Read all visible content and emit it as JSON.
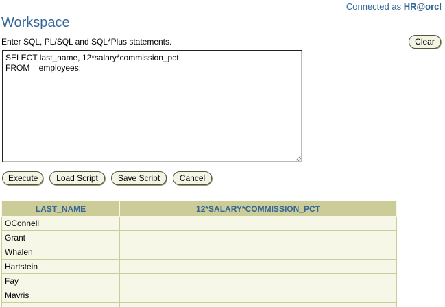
{
  "connection": {
    "prefix": "Connected as ",
    "user": "HR@orcl"
  },
  "page_title": "Workspace",
  "instructions": "Enter SQL, PL/SQL and SQL*Plus statements.",
  "buttons": {
    "clear": "Clear",
    "execute": "Execute",
    "load_script": "Load Script",
    "save_script": "Save Script",
    "cancel": "Cancel"
  },
  "editor": {
    "value": "SELECT last_name, 12*salary*commission_pct\nFROM    employees;"
  },
  "results": {
    "columns": [
      "LAST_NAME",
      "12*SALARY*COMMISSION_PCT"
    ],
    "rows": [
      [
        "OConnell",
        ""
      ],
      [
        "Grant",
        ""
      ],
      [
        "Whalen",
        ""
      ],
      [
        "Hartstein",
        ""
      ],
      [
        "Fay",
        ""
      ],
      [
        "Mavris",
        ""
      ],
      [
        "",
        ""
      ]
    ]
  }
}
